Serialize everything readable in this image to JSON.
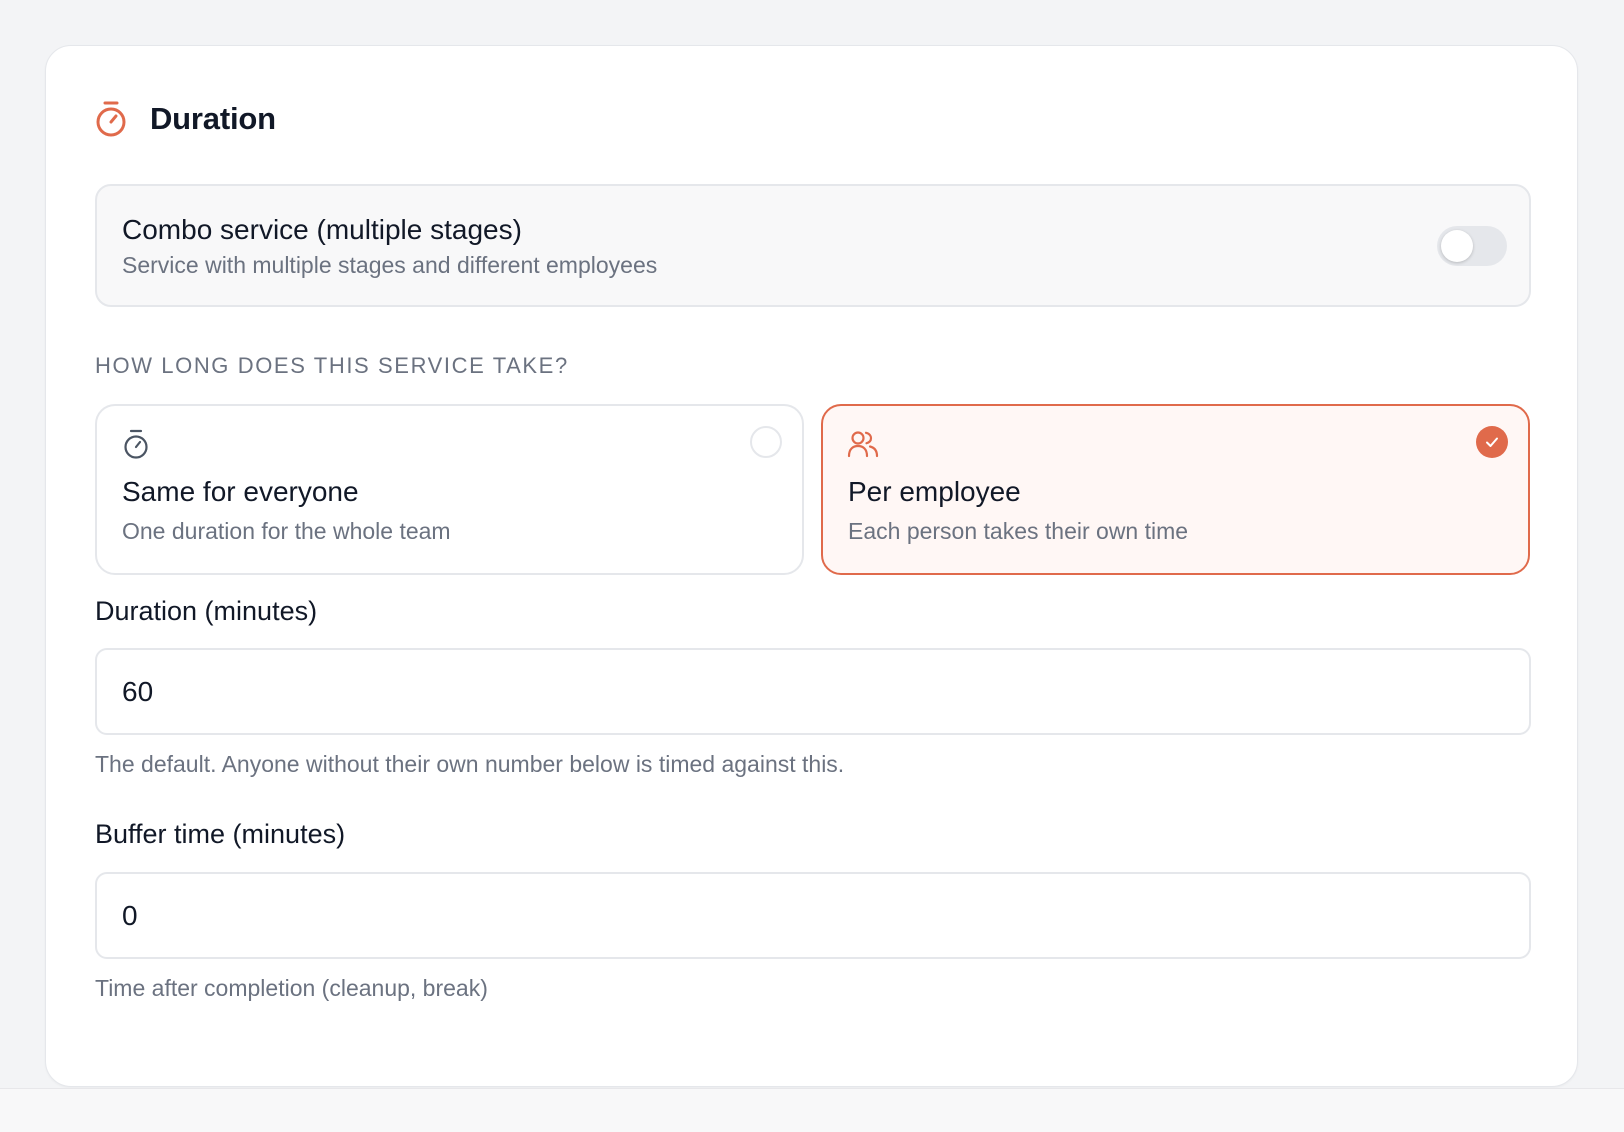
{
  "section": {
    "title": "Duration",
    "icon": "stopwatch-icon",
    "accent_color": "#e06a4b"
  },
  "combo": {
    "title": "Combo service (multiple stages)",
    "subtitle": "Service with multiple stages and different employees",
    "enabled": false
  },
  "question": {
    "label": "HOW LONG DOES THIS SERVICE TAKE?",
    "options": [
      {
        "icon": "stopwatch-icon",
        "title": "Same for everyone",
        "subtitle": "One duration for the whole team",
        "selected": false
      },
      {
        "icon": "users-icon",
        "title": "Per employee",
        "subtitle": "Each person takes their own time",
        "selected": true
      }
    ]
  },
  "duration": {
    "label": "Duration (minutes)",
    "value": "60",
    "help": "The default. Anyone without their own number below is timed against this."
  },
  "buffer": {
    "label": "Buffer time (minutes)",
    "value": "0",
    "help": "Time after completion (cleanup, break)"
  }
}
